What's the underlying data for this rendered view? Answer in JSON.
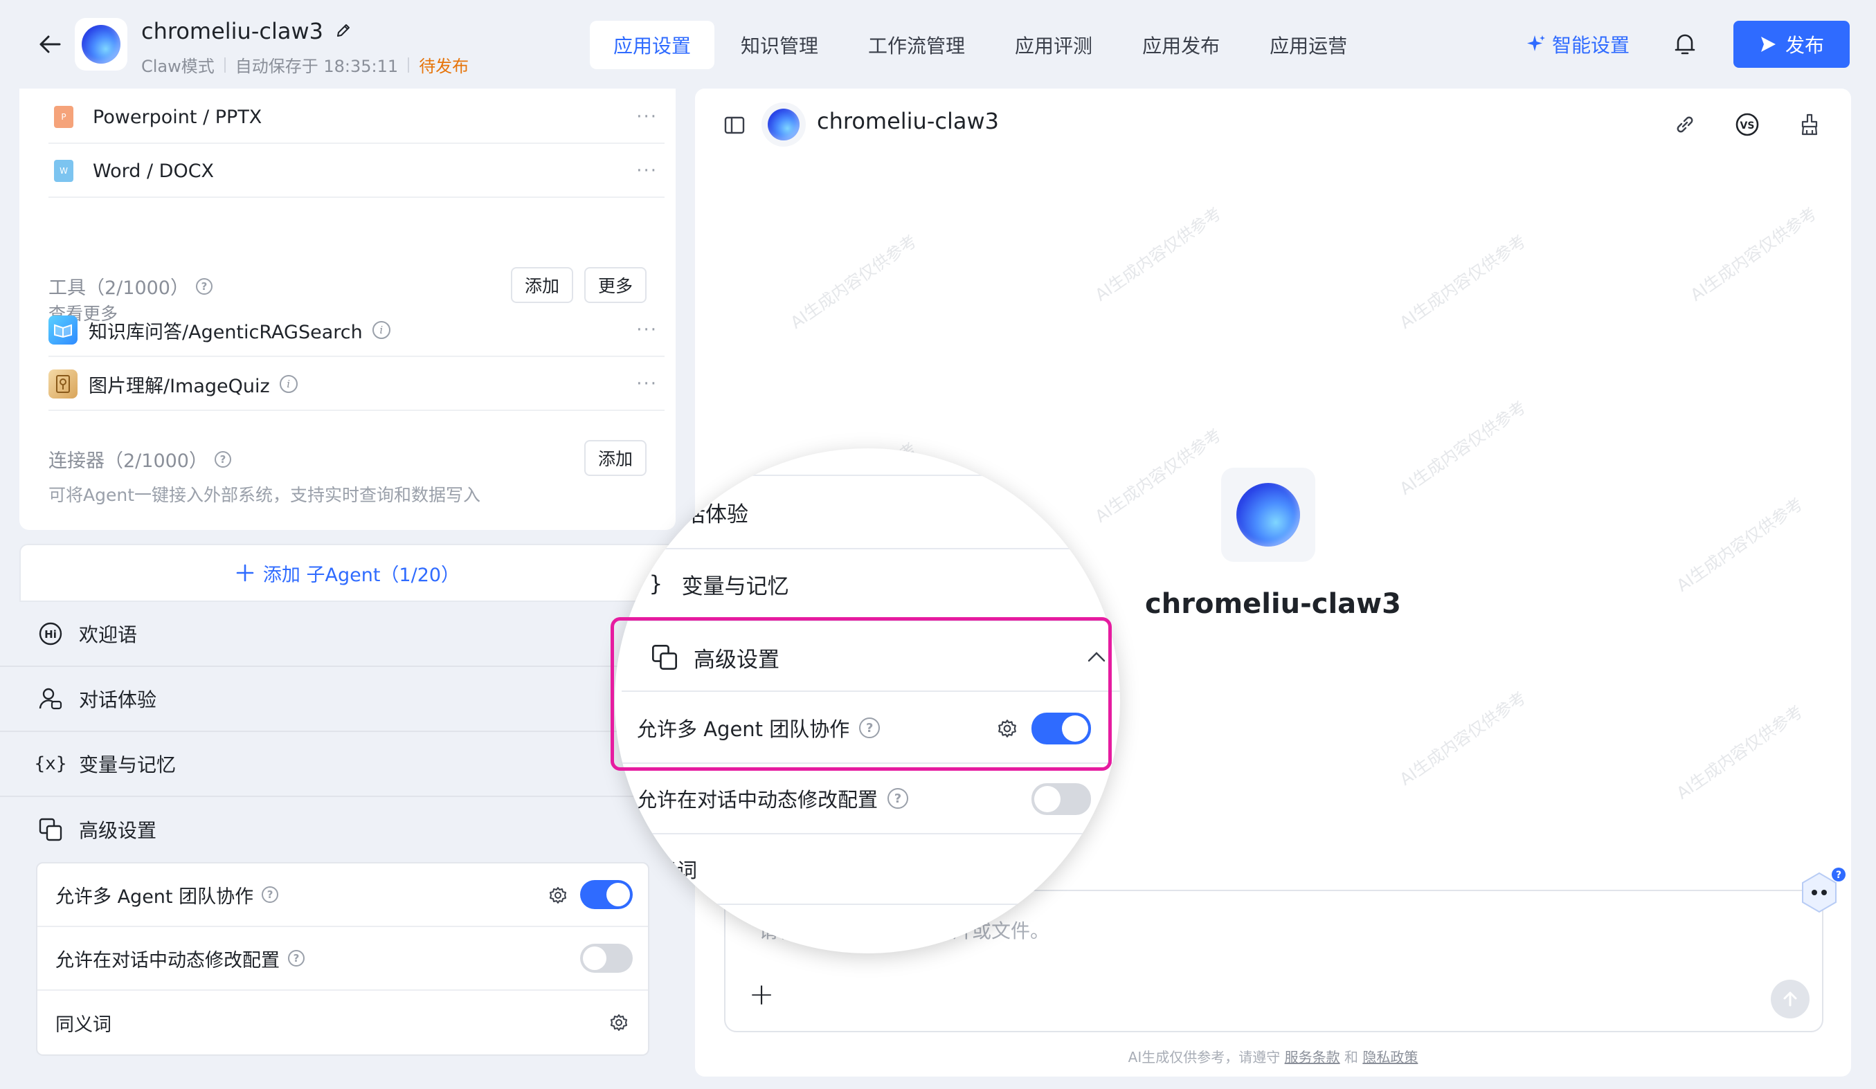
{
  "header": {
    "app_name": "chromeliu-claw3",
    "mode": "Claw模式",
    "autosave": "自动保存于 18:35:11",
    "status": "待发布",
    "tabs": [
      "应用设置",
      "知识管理",
      "工作流管理",
      "应用评测",
      "应用发布",
      "应用运营"
    ],
    "active_tab": 0,
    "smart_settings": "智能设置",
    "publish": "发布"
  },
  "files": [
    {
      "label": "Powerpoint / PPTX",
      "icon": "pptx-file-icon",
      "color": "#f5a37a",
      "glyph": "P"
    },
    {
      "label": "Word / DOCX",
      "icon": "docx-file-icon",
      "color": "#7cc4f0",
      "glyph": "W"
    }
  ],
  "see_more": "查看更多",
  "tools": {
    "title": "工具（2/1000）",
    "add": "添加",
    "more": "更多",
    "items": [
      {
        "label": "知识库问答/AgenticRAGSearch",
        "icon": "knowledge-book-icon"
      },
      {
        "label": "图片理解/ImageQuiz",
        "icon": "image-quiz-icon"
      }
    ]
  },
  "connectors": {
    "title": "连接器（2/1000）",
    "add": "添加",
    "desc": "可将Agent一键接入外部系统，支持实时查询和数据写入"
  },
  "add_sub_agent": "添加 子Agent（1/20）",
  "sections": [
    {
      "label": "欢迎语",
      "icon": "hi-icon"
    },
    {
      "label": "对话体验",
      "icon": "user-chat-icon"
    },
    {
      "label": "变量与记忆",
      "icon": "variable-icon"
    },
    {
      "label": "高级设置",
      "icon": "advanced-copy-icon"
    }
  ],
  "advanced": {
    "multi_agent": "允许多 Agent 团队协作",
    "multi_agent_on": true,
    "dynamic_config": "允许在对话中动态修改配置",
    "dynamic_config_on": false,
    "synonyms": "同义词"
  },
  "magnifier": {
    "row_experience_partial": "话体验",
    "row_variables": "变量与记忆",
    "row_advanced": "高级设置",
    "row_multi_agent": "允许多 Agent 团队协作",
    "row_dynamic": "允许在对话中动态修改配置",
    "row_synonyms_partial": "同义词"
  },
  "preview": {
    "title": "chromeliu-claw3",
    "center_name": "chromeliu-claw3",
    "input_placeholder": "请输入问题，可上传图片或文件。",
    "footer_prefix": "AI生成仅供参考，请遵守",
    "footer_terms": "服务条款",
    "footer_and": "和",
    "footer_privacy": "隐私政策",
    "watermark": "AI生成内容仅供参考"
  },
  "colors": {
    "accent": "#2f6bff",
    "status_orange": "#e6740a",
    "highlight_magenta": "#e61ca0"
  }
}
